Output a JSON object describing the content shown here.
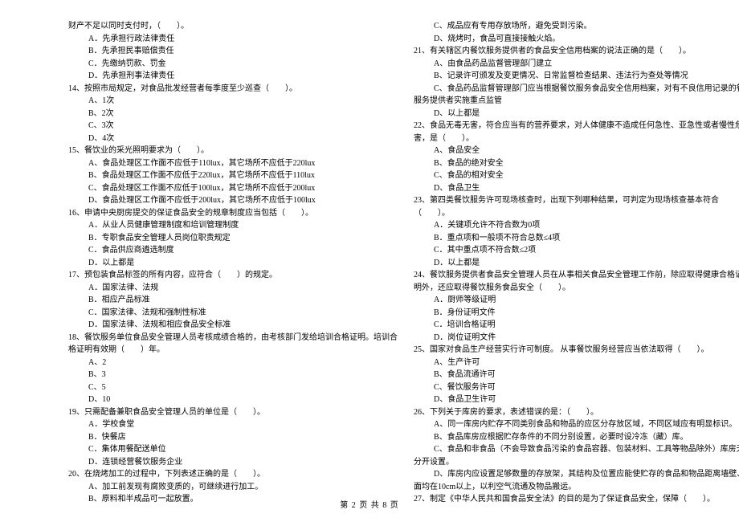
{
  "left": [
    {
      "cls": "line",
      "t": "财产不足以同时支付时，（　　）。"
    },
    {
      "cls": "line indent1",
      "t": "A．先承担行政法律责任"
    },
    {
      "cls": "line indent1",
      "t": "B．先承担民事赔偿责任"
    },
    {
      "cls": "line indent1",
      "t": "C．先缴纳罚款、罚金"
    },
    {
      "cls": "line indent1",
      "t": "D．先承担刑事法律责任"
    },
    {
      "cls": "line",
      "t": "14、按照市局规定，对食品批发经营者每季度至少巡查（　　）。"
    },
    {
      "cls": "line indent1",
      "t": "A、1次"
    },
    {
      "cls": "line indent1",
      "t": "B、2次"
    },
    {
      "cls": "line indent1",
      "t": "C、3次"
    },
    {
      "cls": "line indent1",
      "t": "D、4次"
    },
    {
      "cls": "line",
      "t": "15、餐饮业的采光照明要求为（　　）。"
    },
    {
      "cls": "line indent1",
      "t": "A、食品处理区工作面不应低于110lux，其它场所不应低于220lux"
    },
    {
      "cls": "line indent1",
      "t": "B、食品处理区工作面不应低于220lux，其它场所不应低于110lux"
    },
    {
      "cls": "line indent1",
      "t": "C、食品处理区工作面不应低于100lux，其它场所不应低于200lux"
    },
    {
      "cls": "line indent1",
      "t": "D、食品处理区工作面不应低于200lux，其它场所不应低于100lux"
    },
    {
      "cls": "line",
      "t": "16、申请中央厨房提交的保证食品安全的规章制度应当包括（　　）。"
    },
    {
      "cls": "line indent1",
      "t": "A．从业人员健康管理制度和培训管理制度"
    },
    {
      "cls": "line indent1",
      "t": "B．专职食品安全管理人员岗位职责规定"
    },
    {
      "cls": "line indent1",
      "t": "C．食品供应商遴选制度"
    },
    {
      "cls": "line indent1",
      "t": "D．以上都是"
    },
    {
      "cls": "line",
      "t": "17、预包装食品标签的所有内容，应符合（　　）的规定。"
    },
    {
      "cls": "line indent1",
      "t": "A．国家法律、法规"
    },
    {
      "cls": "line indent1",
      "t": "B．相应产品标准"
    },
    {
      "cls": "line indent1",
      "t": "C．国家法律、法规和强制性标准"
    },
    {
      "cls": "line indent1",
      "t": "D．国家法律、法规和相应食品安全标准"
    },
    {
      "cls": "line",
      "t": "18、餐饮服务单位食品安全管理人员考核成绩合格的，由考核部门发给培训合格证明。培训合"
    },
    {
      "cls": "line",
      "t": "格证明有效期（　　）年。"
    },
    {
      "cls": "line indent1",
      "t": "A、2"
    },
    {
      "cls": "line indent1",
      "t": "B、3"
    },
    {
      "cls": "line indent1",
      "t": "C、5"
    },
    {
      "cls": "line indent1",
      "t": "D、10"
    },
    {
      "cls": "line",
      "t": "19、只需配备兼职食品安全管理人员的单位是（　　）。"
    },
    {
      "cls": "line indent1",
      "t": "A．学校食堂"
    },
    {
      "cls": "line indent1",
      "t": "B．快餐店"
    },
    {
      "cls": "line indent1",
      "t": "C．集体用餐配送单位"
    },
    {
      "cls": "line indent1",
      "t": "D．连锁经营餐饮服务企业"
    },
    {
      "cls": "line",
      "t": "20、在烧烤加工的过程中，下列表述正确的是（　　）。"
    },
    {
      "cls": "line indent1",
      "t": "A、加工前发现有腐败变质的，可继续进行加工。"
    },
    {
      "cls": "line indent1",
      "t": "B、原料和半成品可一起放置。"
    }
  ],
  "right": [
    {
      "cls": "line indent1",
      "t": "C、成品应有专用存放场所，避免受到污染。"
    },
    {
      "cls": "line indent1",
      "t": "D、烧烤时，食品可直接接触火焰。"
    },
    {
      "cls": "line",
      "t": "21、有关辖区内餐饮服务提供者的食品安全信用档案的说法正确的是（　　）。"
    },
    {
      "cls": "line indent1",
      "t": "A、由食品药品监督管理部门建立"
    },
    {
      "cls": "line indent1",
      "t": "B、记录许可颁发及变更情况、日常监督检查结果、违法行为查处等情况"
    },
    {
      "cls": "line indent1",
      "t": "C、食品药品监督管理部门应当根据餐饮服务食品安全信用档案，对有不良信用记录的餐饮"
    },
    {
      "cls": "line",
      "t": "服务提供者实施重点监管"
    },
    {
      "cls": "line indent1",
      "t": "D、以上都是"
    },
    {
      "cls": "line",
      "t": "22、食品无毒无害，符合应当有的营养要求，对人体健康不造成任何急性、亚急性或者慢性危"
    },
    {
      "cls": "line",
      "t": "害，是（　　）。"
    },
    {
      "cls": "line indent1",
      "t": "A、食品安全"
    },
    {
      "cls": "line indent1",
      "t": "B、食品的绝对安全"
    },
    {
      "cls": "line indent1",
      "t": "C、食品的相对安全"
    },
    {
      "cls": "line indent1",
      "t": "D、食品卫生"
    },
    {
      "cls": "line",
      "t": "23、第四类餐饮服务许可现场核查时，出现下列哪种结果，可判定为现场核查基本符合"
    },
    {
      "cls": "line",
      "t": "（　　）。"
    },
    {
      "cls": "line indent1",
      "t": "A．关键项允许不符合数为0项"
    },
    {
      "cls": "line indent1",
      "t": "B．重点项和一般项不符合总数≤4项"
    },
    {
      "cls": "line indent1",
      "t": "C．其中重点项不符合数≤2项"
    },
    {
      "cls": "line indent1",
      "t": "D．以上都是"
    },
    {
      "cls": "line",
      "t": "24、餐饮服务提供者食品安全管理人员在从事相关食品安全管理工作前，除应取得健康合格证"
    },
    {
      "cls": "line",
      "t": "明外，还应取得餐饮服务食品安全（　　）。"
    },
    {
      "cls": "line indent1",
      "t": "A．厨师等级证明"
    },
    {
      "cls": "line indent1",
      "t": "B．身份证明文件"
    },
    {
      "cls": "line indent1",
      "t": "C．培训合格证明"
    },
    {
      "cls": "line indent1",
      "t": "D．岗位证明文件"
    },
    {
      "cls": "line",
      "t": "25、国家对食品生产经营实行许可制度。 从事餐饮服务经营应当依法取得（　　）。"
    },
    {
      "cls": "line indent1",
      "t": "A、生产许可"
    },
    {
      "cls": "line indent1",
      "t": "B、食品流通许可"
    },
    {
      "cls": "line indent1",
      "t": "C、餐饮服务许可"
    },
    {
      "cls": "line indent1",
      "t": "D、食品卫生许可"
    },
    {
      "cls": "line",
      "t": "26、下列关于库房的要求，表述错误的是：（　　）。"
    },
    {
      "cls": "line indent1",
      "t": "A、同一库房内贮存不同类别食品和物品的应区分存放区域，不同区域应有明显标识。"
    },
    {
      "cls": "line indent1",
      "t": "B、食品库房应根据贮存条件的不同分别设置，必要时设冷冻（藏）库。"
    },
    {
      "cls": "line indent1",
      "t": "C、食品和非食品（不会导致食品污染的食品容器、包装材料、工具等物品除外）库房无需"
    },
    {
      "cls": "line",
      "t": "分开设置。"
    },
    {
      "cls": "line indent1",
      "t": "D、库房内应设置足够数量的存放架，其结构及位置应能使贮存的食品和物品距离墙壁、地"
    },
    {
      "cls": "line",
      "t": "面均在10cm以上，以利空气流通及物品搬运。"
    },
    {
      "cls": "line",
      "t": "27、制定《中华人民共和国食品安全法》的目的是为了保证食品安全，保障（　　）。"
    }
  ],
  "footer": "第 2 页 共 8 页"
}
